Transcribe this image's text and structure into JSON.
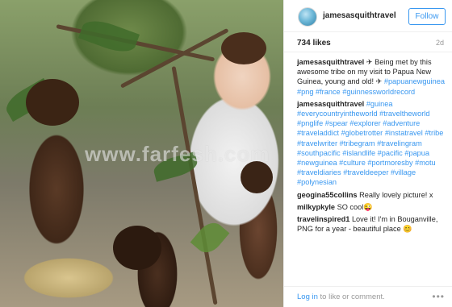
{
  "post": {
    "username": "jamesasquithtravel",
    "follow_label": "Follow",
    "likes": "734 likes",
    "time": "2d",
    "watermark": "www.farfesh.com"
  },
  "caption": {
    "user": "jamesasquithtravel",
    "text1": "✈ Being met by this awesome tribe on my visit to Papua New Guinea, young and old! ✈",
    "tags": [
      "#papuanewguinea",
      "#png",
      "#france",
      "#guinnessworldrecord"
    ]
  },
  "hashtag_comment": {
    "user": "jamesasquithtravel",
    "tags": [
      "#guinea",
      "#everycountryintheworld",
      "#traveltheworld",
      "#pnglife",
      "#spear",
      "#explorer",
      "#adventure",
      "#traveladdict",
      "#globetrotter",
      "#instatravel",
      "#tribe",
      "#travelwriter",
      "#tribegram",
      "#travelingram",
      "#southpacific",
      "#islandlife",
      "#pacific",
      "#papua",
      "#newguinea",
      "#culture",
      "#portmoresby",
      "#motu",
      "#traveldiaries",
      "#traveldeeper",
      "#village",
      "#polynesian"
    ]
  },
  "comments": [
    {
      "user": "geogina55collins",
      "text": "Really lovely picture! x"
    },
    {
      "user": "milkypkyle",
      "text": "SO cool😜"
    },
    {
      "user": "travelinspired1",
      "text": "Love it! I'm in Bouganville, PNG for a year - beautiful place 😊"
    }
  ],
  "footer": {
    "login_link": "Log in",
    "login_rest": " to like or comment.",
    "more": "•••"
  },
  "colors": {
    "link": "#3897f0",
    "text": "#262626",
    "muted": "#999999"
  }
}
